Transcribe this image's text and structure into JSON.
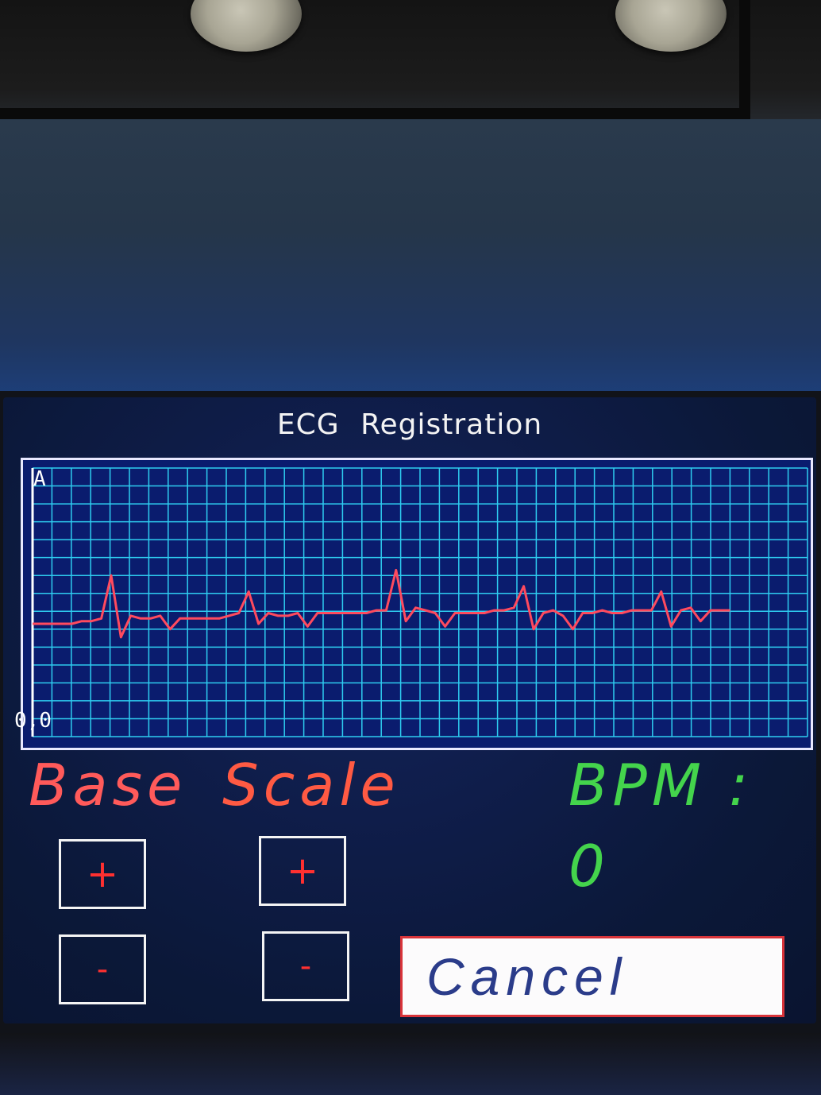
{
  "screen": {
    "title": "ECG Registration",
    "plot": {
      "y_max_label": "A",
      "y_min_label": "0,0",
      "colors": {
        "background": "#0a1c6e",
        "grid": "#2ecdf0",
        "trace": "#ff4a5e",
        "axis": "#ffffff"
      }
    },
    "base_label": "Base",
    "scale_label": "Scale",
    "bpm_label": "BPM :",
    "bpm_value": "0",
    "buttons": {
      "base_plus": "+",
      "base_minus": "-",
      "scale_plus": "+",
      "scale_minus": "-",
      "cancel": "Cancel"
    }
  },
  "chart_data": {
    "type": "line",
    "ylim": [
      0,
      1
    ],
    "grid": true,
    "series": [
      {
        "values": [
          0.42,
          0.42,
          0.42,
          0.42,
          0.42,
          0.43,
          0.43,
          0.44,
          0.6,
          0.37,
          0.45,
          0.44,
          0.44,
          0.45,
          0.4,
          0.44,
          0.44,
          0.44,
          0.44,
          0.44,
          0.45,
          0.46,
          0.54,
          0.42,
          0.46,
          0.45,
          0.45,
          0.46,
          0.41,
          0.46,
          0.46,
          0.46,
          0.46,
          0.46,
          0.46,
          0.47,
          0.47,
          0.62,
          0.43,
          0.48,
          0.47,
          0.46,
          0.41,
          0.46,
          0.46,
          0.46,
          0.46,
          0.47,
          0.47,
          0.48,
          0.56,
          0.4,
          0.46,
          0.47,
          0.45,
          0.4,
          0.46,
          0.46,
          0.47,
          0.46,
          0.46,
          0.47,
          0.47,
          0.47,
          0.54,
          0.41,
          0.47,
          0.48,
          0.43,
          0.47,
          0.47,
          0.47
        ]
      }
    ]
  }
}
